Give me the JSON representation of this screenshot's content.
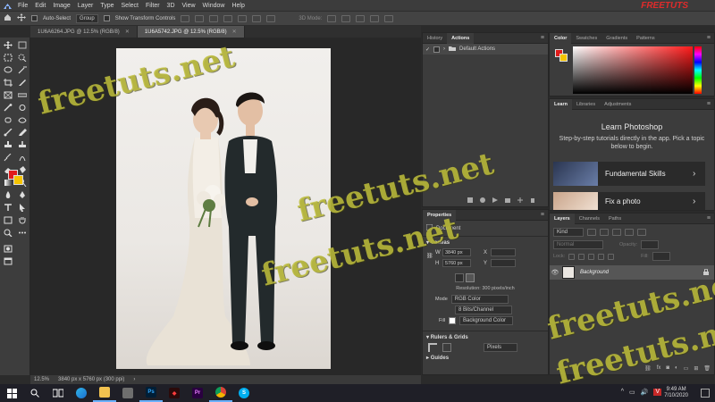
{
  "menubar": {
    "app_icon": "photoshop-logo-icon",
    "items": [
      "File",
      "Edit",
      "Image",
      "Layer",
      "Type",
      "Select",
      "Filter",
      "3D",
      "View",
      "Window",
      "Help"
    ],
    "brand": "FREETUTS"
  },
  "options_bar": {
    "auto_select_label": "Auto-Select",
    "group_select": "Group",
    "transform_controls_label": "Show Transform Controls",
    "mode_3d_label": "3D Mode:"
  },
  "document_tabs": [
    {
      "label": "1U6A6264.JPG @ 12.5% (RGB/8)",
      "active": false
    },
    {
      "label": "1U6A5742.JPG @ 12.5% (RGB/8)",
      "active": true
    }
  ],
  "status_bar": {
    "zoom": "12.5%",
    "doc_size": "3840 px x 5760 px (300 ppi)"
  },
  "history_panel": {
    "tabs": [
      "History",
      "Actions"
    ],
    "active_tab": "Actions",
    "item_label": "Default Actions"
  },
  "color_panel": {
    "tabs": [
      "Color",
      "Swatches",
      "Gradients",
      "Patterns"
    ],
    "fg_color": "#e01b1b",
    "bg_color": "#f5c400"
  },
  "learn_panel": {
    "tabs": [
      "Learn",
      "Libraries",
      "Adjustments"
    ],
    "title": "Learn Photoshop",
    "subtitle": "Step-by-step tutorials directly in the app. Pick a topic below to begin.",
    "cards": [
      "Fundamental Skills",
      "Fix a photo"
    ]
  },
  "properties_panel": {
    "tab": "Properties",
    "doc_label": "Document",
    "canvas_heading": "Canvas",
    "w_label": "W",
    "w_value": "3840 px",
    "h_label": "H",
    "h_value": "5760 px",
    "x_label": "X",
    "y_label": "Y",
    "resolution": "Resolution: 300 pixels/inch",
    "mode_label": "Mode",
    "mode_value": "RGB Color",
    "depth_value": "8 Bits/Channel",
    "fill_label": "Fill",
    "fill_value": "Background Color",
    "rulers_heading": "Rulers & Grids",
    "units_value": "Pixels",
    "guides_heading": "Guides"
  },
  "layers_panel": {
    "tabs": [
      "Layers",
      "Channels",
      "Paths"
    ],
    "search_placeholder": "Kind",
    "blend_mode": "Normal",
    "opacity_label": "Opacity:",
    "lock_label": "Lock:",
    "fill_label": "Fill:",
    "layer_name": "Background"
  },
  "taskbar": {
    "apps": [
      "windows-start-icon",
      "search-icon",
      "task-view-icon",
      "edge-icon",
      "file-explorer-icon",
      "store-icon",
      "photoshop-icon",
      "adobe-icon",
      "premiere-icon",
      "chrome-icon",
      "skype-icon"
    ],
    "time": "9:49 AM",
    "date": "7/10/2020"
  },
  "watermark_text": "freetuts.net"
}
